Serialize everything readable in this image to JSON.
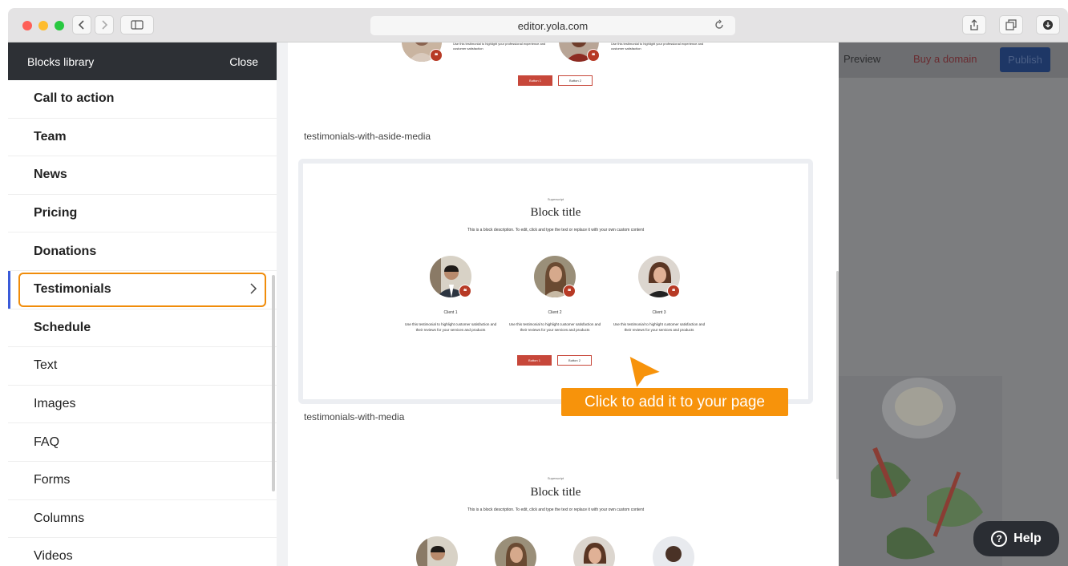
{
  "browser": {
    "url": "editor.yola.com"
  },
  "sidebar": {
    "title": "Blocks library",
    "close_label": "Close",
    "items": [
      {
        "label": "Call to action"
      },
      {
        "label": "Team"
      },
      {
        "label": "News"
      },
      {
        "label": "Pricing"
      },
      {
        "label": "Donations"
      },
      {
        "label": "Testimonials"
      },
      {
        "label": "Schedule"
      },
      {
        "label": "Text"
      },
      {
        "label": "Images"
      },
      {
        "label": "FAQ"
      },
      {
        "label": "Forms"
      },
      {
        "label": "Columns"
      },
      {
        "label": "Videos"
      }
    ],
    "active_item": "Testimonials"
  },
  "preview": {
    "top_block": {
      "text_1": "Use this testimonial to highlight your professional experience and customer satisfaction",
      "text_2": "Use this testimonial to highlight your professional experience and customer satisfaction",
      "button_1": "Button 1",
      "button_2": "Button 2"
    },
    "block_1": {
      "caption": "testimonials-with-aside-media",
      "superscript": "Superscript",
      "title": "Block title",
      "description": "This is a block description. To edit, click and type the text or replace it with your own custom content",
      "clients": [
        {
          "name": "Client 1",
          "text": "Use this testimonial to highlight customer satisfaction and their reviews for your services and products"
        },
        {
          "name": "Client 2",
          "text": "Use this testimonial to highlight customer satisfaction and their reviews for your services and products"
        },
        {
          "name": "Client 3",
          "text": "Use this testimonial to highlight customer satisfaction and their reviews for your services and products"
        }
      ],
      "button_1": "Button 1",
      "button_2": "Button 2"
    },
    "block_2": {
      "caption": "testimonials-with-media",
      "superscript": "Superscript",
      "title": "Block title",
      "description": "This is a block description. To edit, click and type the text or replace it with your own custom content"
    },
    "tooltip": "Click to add it to your page"
  },
  "editor_topbar": {
    "preview_label": "Preview",
    "buy_domain_label": "Buy a domain",
    "publish_label": "Publish"
  },
  "help": {
    "label": "Help"
  },
  "colors": {
    "accent_orange": "#f7930b",
    "active_marker": "#3a5bd9",
    "button_red": "#c7473a",
    "sidebar_header": "#2d3035"
  }
}
